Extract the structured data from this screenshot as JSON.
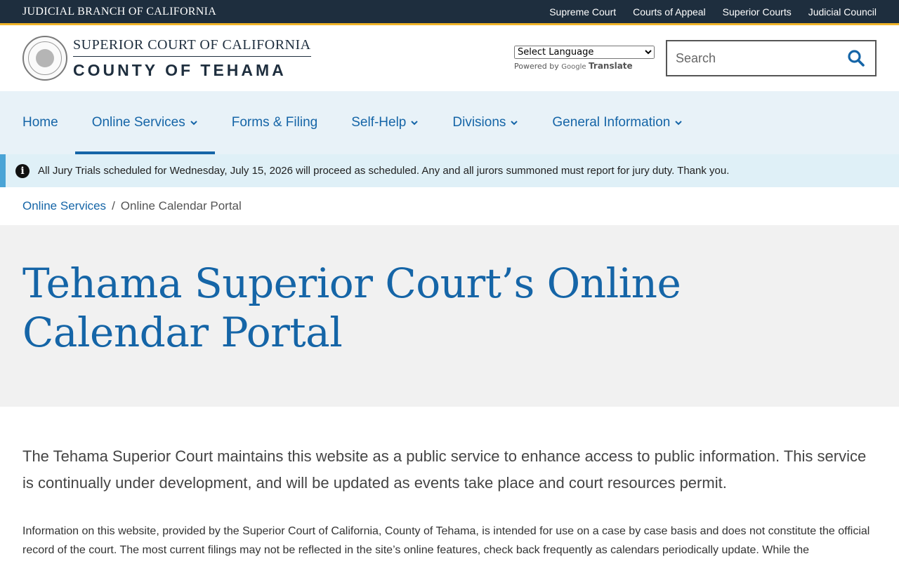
{
  "topbar": {
    "branch": "JUDICIAL BRANCH OF CALIFORNIA",
    "links": [
      "Supreme Court",
      "Courts of Appeal",
      "Superior Courts",
      "Judicial Council"
    ]
  },
  "header": {
    "line1": "SUPERIOR COURT OF CALIFORNIA",
    "line2": "COUNTY OF TEHAMA",
    "translate": {
      "select_label": "Select Language",
      "powered": "Powered by",
      "google": "Google",
      "translate": "Translate"
    },
    "search": {
      "placeholder": "Search"
    }
  },
  "nav": {
    "items": [
      {
        "label": "Home"
      },
      {
        "label": "Online Services"
      },
      {
        "label": "Forms & Filing"
      },
      {
        "label": "Self-Help"
      },
      {
        "label": "Divisions"
      },
      {
        "label": "General Information"
      }
    ]
  },
  "alert": {
    "message": "All Jury Trials scheduled for Wednesday, July 15, 2026 will proceed as scheduled.  Any and all jurors summoned must report for jury duty. Thank you."
  },
  "breadcrumb": {
    "parent": "Online Services",
    "separator": "/",
    "current": "Online Calendar Portal"
  },
  "hero": {
    "title": "Tehama Superior Court’s Online Calendar Portal"
  },
  "content": {
    "lead": "The Tehama Superior Court maintains this website as a public service to enhance access to public information. This service is continually under development, and will be updated as events take place and court resources permit.",
    "body": "Information on this website, provided by the Superior Court of California, County of Tehama, is intended for use on a case by case basis and does not constitute the official record of the court. The most current filings may not be reflected in the site’s online features, check back frequently as calendars periodically update. While the"
  },
  "colors": {
    "navy": "#1e2e3e",
    "gold": "#f0b429",
    "link": "#1565a7",
    "navBg": "#e8f2f8",
    "alertBg": "#dff0f7"
  },
  "icons": {
    "search": "search-icon",
    "info": "info-icon",
    "chevron": "chevron-down-icon",
    "seal": "court-seal-logo"
  }
}
